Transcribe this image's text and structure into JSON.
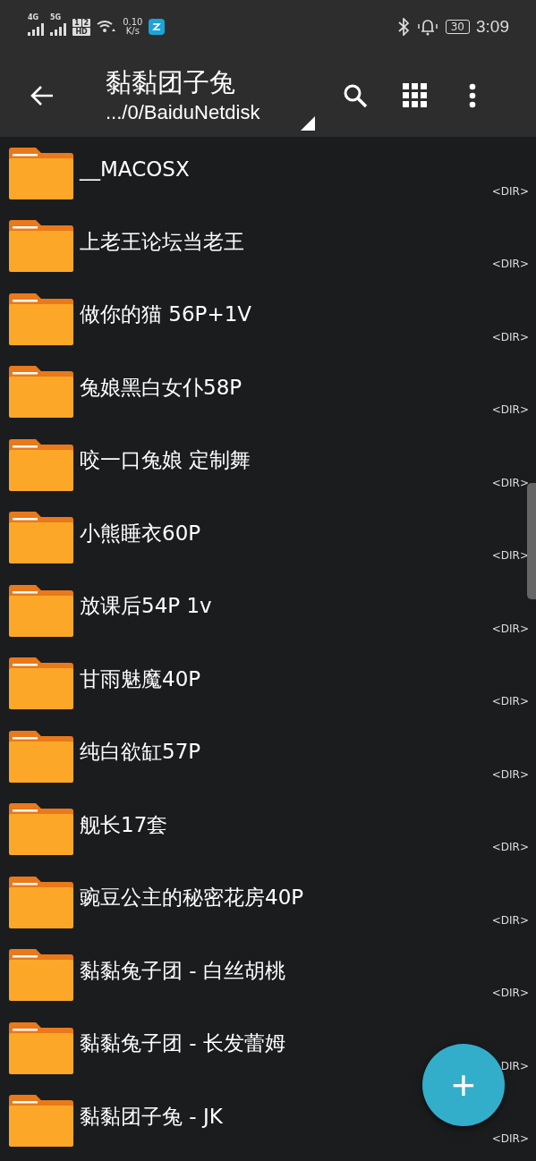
{
  "status_bar": {
    "sim1_label": "4G",
    "sim2_label": "5G",
    "hd_badge": {
      "slot1": "1",
      "slot2": "2",
      "label": "HD"
    },
    "speed_value": "0.10",
    "speed_unit": "K/s",
    "battery": "30",
    "time": "3:09"
  },
  "toolbar": {
    "title": "黏黏团子兔",
    "path": ".../0/BaiduNetdisk"
  },
  "files": [
    {
      "name": "__MACOSX",
      "info": "<DIR>"
    },
    {
      "name": "上老王论坛当老王",
      "info": "<DIR>"
    },
    {
      "name": "做你的猫 56P+1V",
      "info": "<DIR>"
    },
    {
      "name": "兔娘黑白女仆58P",
      "info": "<DIR>"
    },
    {
      "name": "咬一口兔娘 定制舞",
      "info": "<DIR>"
    },
    {
      "name": "小熊睡衣60P",
      "info": "<DIR>"
    },
    {
      "name": "放课后54P 1v",
      "info": "<DIR>"
    },
    {
      "name": "甘雨魅魔40P",
      "info": "<DIR>"
    },
    {
      "name": "纯白欲缸57P",
      "info": "<DIR>"
    },
    {
      "name": "舰长17套",
      "info": "<DIR>"
    },
    {
      "name": "豌豆公主的秘密花房40P",
      "info": "<DIR>"
    },
    {
      "name": "黏黏兔子团 - 白丝胡桃",
      "info": "<DIR>"
    },
    {
      "name": "黏黏兔子团 - 长发蕾姆",
      "info": "DIR>"
    },
    {
      "name": "黏黏团子兔 - JK",
      "info": "<DIR>"
    }
  ],
  "fab": {
    "label": "+"
  }
}
